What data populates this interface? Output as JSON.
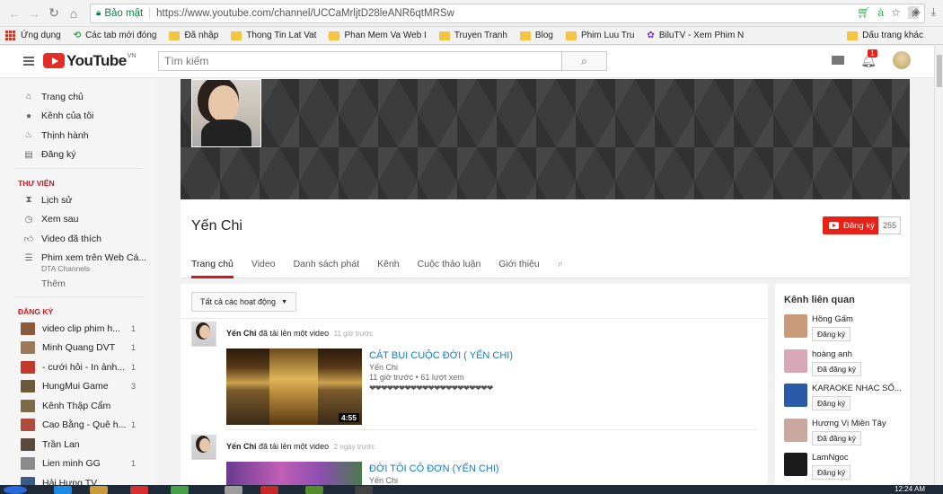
{
  "browser": {
    "secure_label": "Bảo mật",
    "url": "https://www.youtube.com/channel/UCCaMrljtD28leANR6qtMRSw"
  },
  "bookmarks": {
    "items": [
      "Ứng dụng",
      "Các tab mới đóng",
      "Đã nhập",
      "Thong Tin Lat Vat",
      "Phan Mem Va Web I",
      "Truyen Tranh",
      "Blog",
      "Phim Luu Tru",
      "BiluTV - Xem Phim N"
    ],
    "right": "Dấu trang khác"
  },
  "header": {
    "logo_text": "YouTube",
    "logo_region": "VN",
    "search_placeholder": "Tìm kiếm",
    "notification_count": "1"
  },
  "sidebar": {
    "main": [
      {
        "label": "Trang chủ",
        "icon": "home-icon"
      },
      {
        "label": "Kênh của tôi",
        "icon": "account-icon"
      },
      {
        "label": "Thịnh hành",
        "icon": "flame-icon"
      },
      {
        "label": "Đăng ký",
        "icon": "subscriptions-icon"
      }
    ],
    "library_header": "THƯ VIỆN",
    "library": [
      {
        "label": "Lịch sử",
        "icon": "history-icon"
      },
      {
        "label": "Xem sau",
        "icon": "clock-icon"
      },
      {
        "label": "Video đã thích",
        "icon": "thumbs-up-icon"
      },
      {
        "label": "Phim xem trên Web Cá...",
        "icon": "playlist-icon"
      }
    ],
    "playlist_owner": "DTA Channels",
    "more": "Thêm",
    "subs_header": "ĐĂNG KÝ",
    "subscriptions": [
      {
        "label": "video clip phim h...",
        "count": "1",
        "color": "#8a5a3a"
      },
      {
        "label": "Minh Quang DVT",
        "count": "1",
        "color": "#9a7a5a"
      },
      {
        "label": "- cưới hỏi - In ảnh...",
        "count": "1",
        "color": "#c0392b"
      },
      {
        "label": "HungMui Game",
        "count": "3",
        "color": "#6a5a3a"
      },
      {
        "label": "Kênh Thập Cẩm",
        "count": "",
        "color": "#7a6a4a"
      },
      {
        "label": "Cao Bằng - Quê h...",
        "count": "1",
        "color": "#b04a3a"
      },
      {
        "label": "Trần Lan",
        "count": "",
        "color": "#5a4a3a"
      },
      {
        "label": "Lien minh GG",
        "count": "1",
        "color": "#8a8a8a"
      },
      {
        "label": "Hải Hưng TV",
        "count": "",
        "color": "#3a5a8a"
      }
    ]
  },
  "channel": {
    "name": "Yến Chi",
    "subscribe_label": "Đăng ký",
    "subscriber_count": "255",
    "tabs": [
      "Trang chủ",
      "Video",
      "Danh sách phát",
      "Kênh",
      "Cuộc thảo luận",
      "Giới thiệu"
    ]
  },
  "feed": {
    "filter_label": "Tất cả các hoạt động",
    "activities": [
      {
        "user": "Yến Chi",
        "action": "đã tải lên một video",
        "ago": "11 giờ trước",
        "title": "CÁT BỤI CUỘC ĐỜI ( YẾN CHI)",
        "channel": "Yến Chi",
        "stats": "11 giờ trước • 61 lượt xem",
        "desc": "❤❤❤❤❤❤❤❤❤❤❤❤❤❤❤❤❤❤❤❤❤",
        "duration": "4:55"
      },
      {
        "user": "Yến Chi",
        "action": "đã tải lên một video",
        "ago": "2 ngày trước",
        "title": "ĐỜI TÔI CÔ ĐƠN (YẾN CHI)",
        "channel": "Yến Chi"
      }
    ]
  },
  "related": {
    "title": "Kênh liên quan",
    "channels": [
      {
        "name": "Hồng Gấm",
        "button": "Đăng ký",
        "color": "#c99a7a"
      },
      {
        "name": "hoàng anh",
        "button": "Đã đăng ký",
        "color": "#d8a8b8"
      },
      {
        "name": "KARAOKE NHẠC SỐ...",
        "button": "Đăng ký",
        "color": "#2a5aa8"
      },
      {
        "name": "Hương Vị Miền Tây",
        "button": "Đã đăng ký",
        "color": "#caa8a0"
      },
      {
        "name": "LamNgoc",
        "button": "Đăng ký",
        "color": "#1a1a1a"
      }
    ]
  },
  "taskbar": {
    "clock": "12:24 AM"
  }
}
